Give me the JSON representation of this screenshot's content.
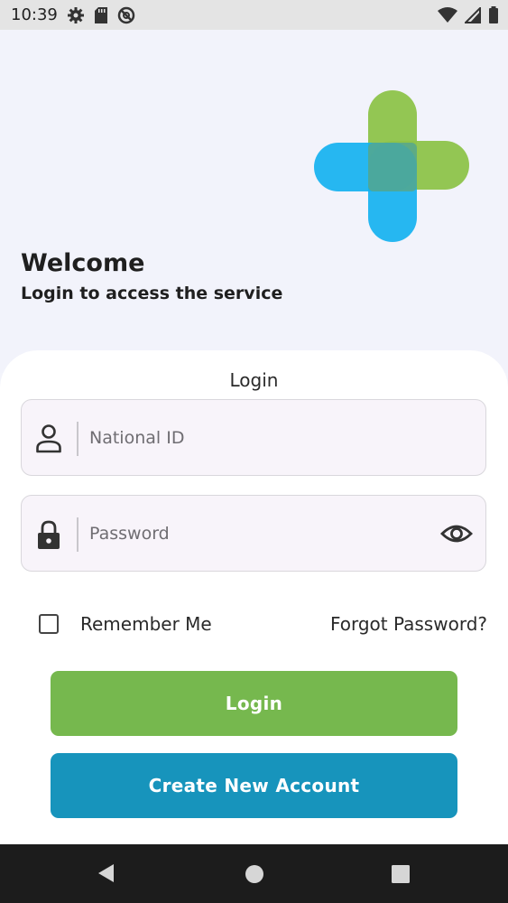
{
  "status_bar": {
    "time": "10:39",
    "left_icons": [
      "settings-icon",
      "sd-card-icon",
      "no-disturb-icon"
    ],
    "right_icons": [
      "wifi-icon",
      "signal-icon",
      "battery-icon"
    ]
  },
  "header": {
    "title": "Welcome",
    "subtitle": "Login to access the service"
  },
  "login_card": {
    "title": "Login",
    "national_id": {
      "placeholder": "National ID",
      "value": "",
      "icon": "person-icon"
    },
    "password": {
      "placeholder": "Password",
      "value": "",
      "icon": "lock-icon",
      "toggle_icon": "eye-icon"
    },
    "remember_me": {
      "label": "Remember Me",
      "checked": false
    },
    "forgot_password": "Forgot Password?",
    "login_button": "Login",
    "create_account_button": "Create New Account"
  },
  "colors": {
    "accent_green": "#76b84e",
    "accent_blue": "#1794bc",
    "logo_green": "#8dc34a",
    "logo_blue": "#0fb0f0"
  },
  "nav_bar": {
    "icons": [
      "back-icon",
      "home-icon",
      "recents-icon"
    ]
  }
}
